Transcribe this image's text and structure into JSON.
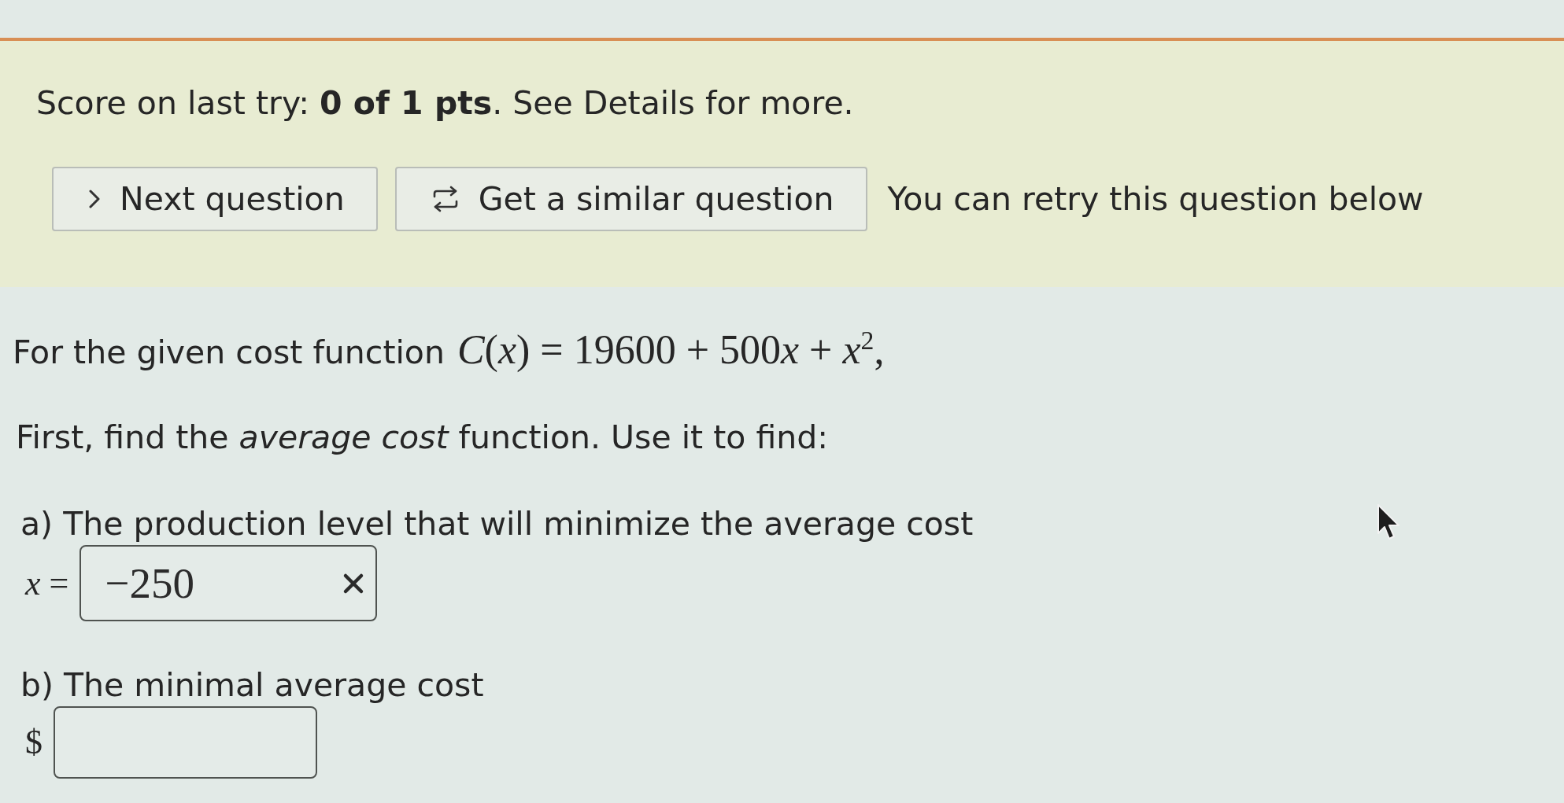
{
  "score": {
    "text": "Score on last try: **0 of 1 pts**. See Details for more."
  },
  "actions": [
    {
      "kind": "next",
      "label": "Next question"
    },
    {
      "kind": "similar",
      "label": "Get a similar question"
    }
  ],
  "retry_note": "You can retry this question below",
  "question": {
    "intro": "For the given cost function",
    "formula": "C(x) = 19600 + 500x + x$^{2}$,",
    "instruction": "First, find the *average cost* function. Use it to find:"
  },
  "parts": [
    {
      "label": "a) The production level that will minimize the average cost",
      "prefix": "x =",
      "value": "−250",
      "correct": false
    },
    {
      "label": "b) The minimal average cost",
      "prefix": "$"
    }
  ]
}
